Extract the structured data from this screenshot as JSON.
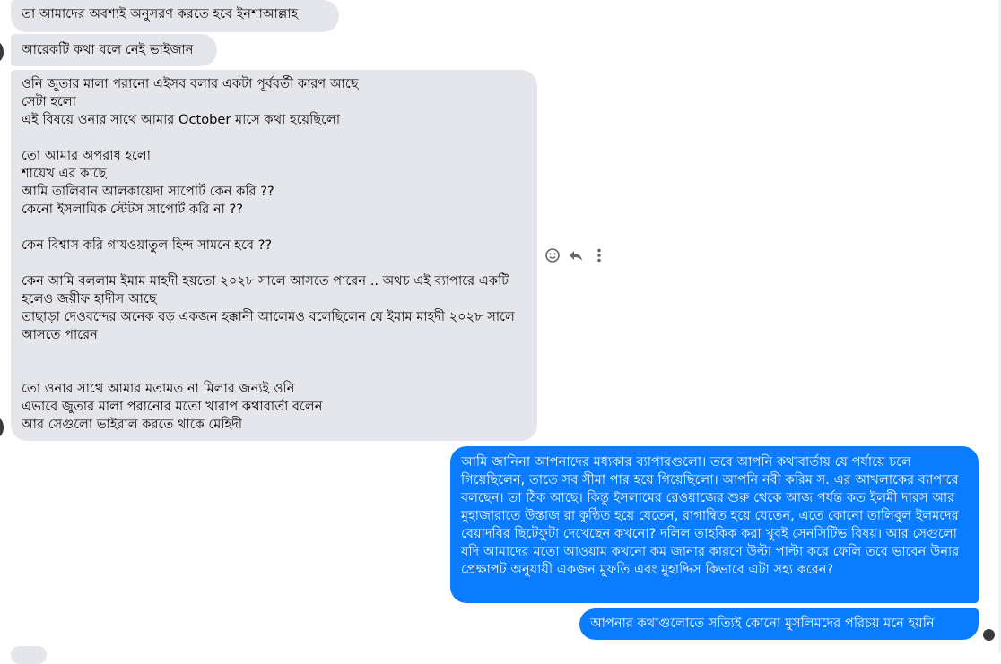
{
  "messages": {
    "incoming": [
      "তা আমাদের অবশ্যই অনুসরণ করতে হবে ইনশাআল্লাহ",
      "আরেকটি কথা বলে নেই ভাইজান",
      "ওনি জুতার মালা পরানো এইসব বলার একটা পূর্ববর্তী কারণ আছে\nসেটা হলো\nএই বিষয়ে ওনার সাথে আমার October মাসে কথা হয়েছিলো\n\nতো আমার অপরাধ হলো\nশায়েখ এর কাছে\nআমি তালিবান আলকায়েদা সাপোর্ট কেন করি ??\nকেনো ইসলামিক স্টেটস সাপোর্ট করি না ??\n\nকেন বিশ্বাস করি গাযওয়াতুল হিন্দ সামনে হবে ??\n\nকেন আমি বললাম ইমাম মাহদী হয়তো ২০২৮ সালে আসতে পারেন .. অথচ এই ব্যাপারে একটি হলেও জয়ীফ হাদীস আছে\nতাছাড়া দেওবন্দের অনেক বড় একজন হক্কানী আলেমও বলেছিলেন যে ইমাম মাহদী ২০২৮ সালে আসতে পারেন\n\n\nতো ওনার সাথে আমার মতামত না মিলার জন্যই ওনি\nএভাবে জুতার মালা পরানোর মতো খারাপ কথাবার্তা বলেন\nআর সেগুলো ভাইরাল করতে থাকে মেহিদী"
    ],
    "outgoing": [
      "আমি জানিনা আপনাদের মধ্যকার ব্যাপারগুলো। তবে আপনি কথাবার্তায় যে পর্যায়ে চলে গিয়েছিলেন, তাতে সব সীমা পার হয়ে গিয়েছিলো। আপনি নবী করিম স. এর আখলাকের ব্যাপারে বলছেন। তা ঠিক আছে। কিন্তু ইসলামের রেওয়াজের শুরু থেকে আজ পর্যন্ত কত ইলমী দারস আর মুহাজারাতে উস্তাজ রা কুন্ঠিত হয়ে যেতেন, রাগান্বিত হয়ে যেতেন, এতে কোনো তালিবুল ইলমদের বেয়াদবির ছিটেফুটা দেখেছেন কখনো? দলিল তাহকিক করা খুবই সেনসিটিভ বিষয়। আর সেগুলো যদি আমাদের মতো আওয়াম কখনো কম জানার কারণে উল্টা পাল্টা করে ফেলি তবে ভাবেন উনার প্রেক্ষাপট অনুযায়ী একজন মুফতি এবং মুহাদ্দিস কিভাবে এটা সহ্য করেন?",
      "আপনার কথাগুলোতে সত্যিই কোনো মুসলিমদের পরিচয় মনে হয়নি"
    ]
  },
  "actions": {
    "react_icon": "smiley-icon",
    "reply_icon": "reply-arrow-icon",
    "more_icon": "vertical-ellipsis-icon"
  },
  "colors": {
    "incoming_bg": "#e4e6eb",
    "outgoing_bg": "#0a7cff"
  }
}
